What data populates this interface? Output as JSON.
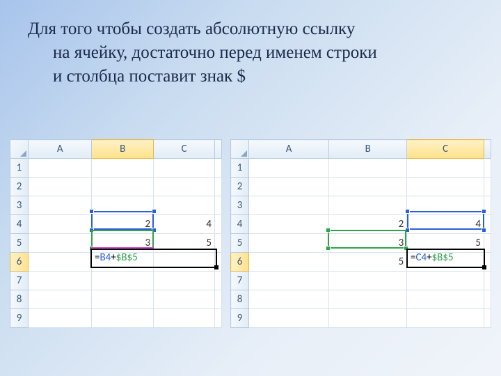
{
  "title": {
    "line1": "Для того чтобы создать абсолютную ссылку",
    "line2": "на ячейку, достаточно перед именем строки",
    "line3": "и столбца поставит знак $"
  },
  "columns": [
    "A",
    "B",
    "C"
  ],
  "rows": [
    "1",
    "2",
    "3",
    "4",
    "5",
    "6",
    "7",
    "8",
    "9"
  ],
  "left": {
    "active_col": "B",
    "active_row": "6",
    "cells": {
      "B4": "2",
      "C4": "4",
      "B5": "3",
      "C5": "5"
    },
    "formula": {
      "eq": "=",
      "ref": "B4",
      "op": "+",
      "abs": "$B$5"
    }
  },
  "right": {
    "active_col": "C",
    "active_row": "6",
    "cells": {
      "B4": "2",
      "C4": "4",
      "B5": "3",
      "C5": "5",
      "B6": "5"
    },
    "formula": {
      "eq": "=",
      "ref": "C4",
      "op": "+",
      "abs": "$B$5"
    }
  }
}
